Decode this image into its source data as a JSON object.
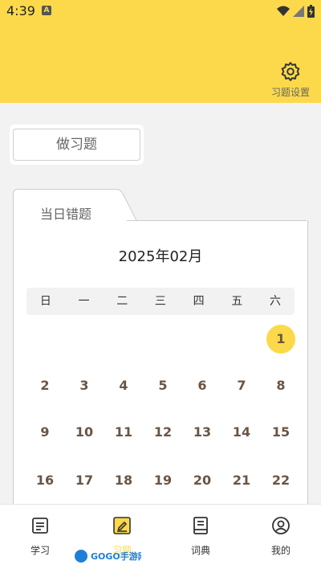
{
  "status_bar": {
    "time": "4:39",
    "badge": "A"
  },
  "header": {
    "settings_label": "习题设置",
    "settings_icon": "gear-icon",
    "background": "#fcd94a"
  },
  "practice": {
    "label": "做习题"
  },
  "tab": {
    "label": "当日错题"
  },
  "calendar": {
    "month_title": "2025年02月",
    "weekdays": [
      "日",
      "一",
      "二",
      "三",
      "四",
      "五",
      "六"
    ],
    "selected_day": "1",
    "days": [
      "1",
      "2",
      "3",
      "4",
      "5",
      "6",
      "7",
      "8",
      "9",
      "10",
      "11",
      "12",
      "13",
      "14",
      "15",
      "16",
      "17",
      "18",
      "19",
      "20",
      "21",
      "22"
    ],
    "selected_color": "#fcd94a"
  },
  "nav": {
    "items": [
      {
        "label": "学习",
        "icon": "document-icon"
      },
      {
        "label": "习题",
        "icon": "edit-icon"
      },
      {
        "label": "词典",
        "icon": "book-icon"
      },
      {
        "label": "我的",
        "icon": "profile-icon"
      }
    ]
  },
  "watermark": {
    "text": "GOGO手游网"
  }
}
